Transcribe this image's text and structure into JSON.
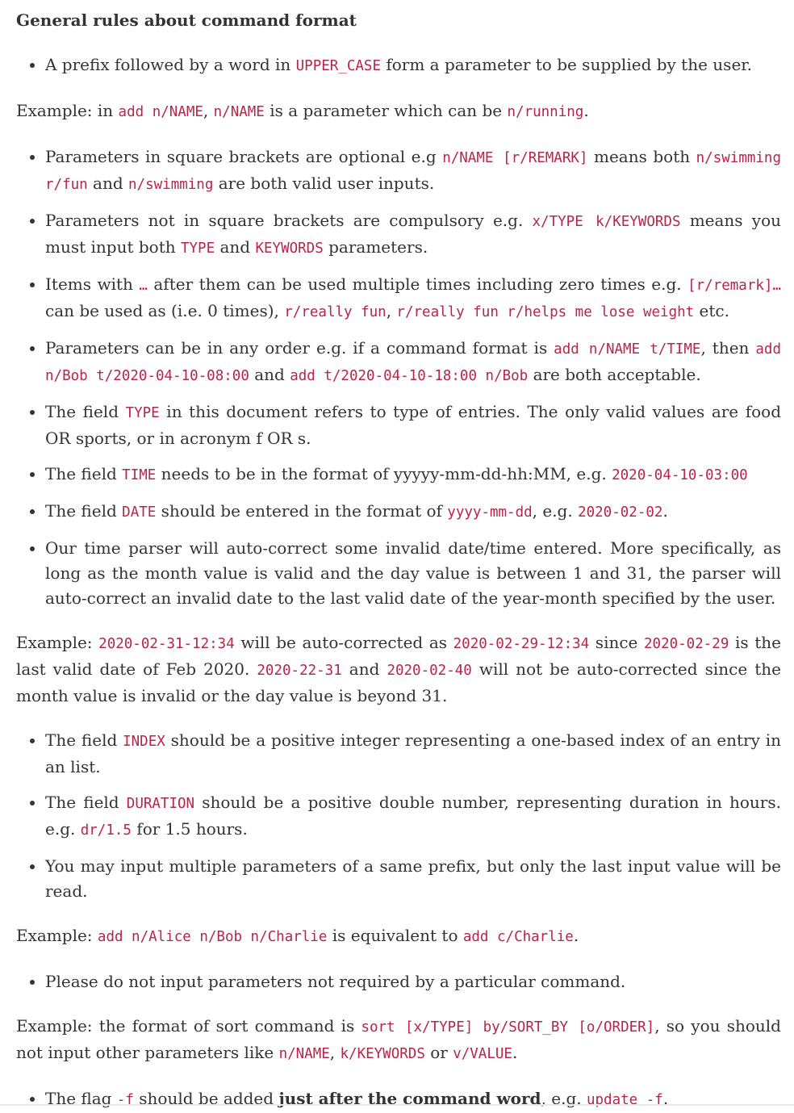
{
  "heading": "General rules about command format",
  "blocks": [
    {
      "type": "ul",
      "items": [
        [
          [
            "t",
            "A prefix followed by a word in "
          ],
          [
            "c",
            "UPPER_CASE"
          ],
          [
            "t",
            " form a parameter to be supplied by the user."
          ]
        ]
      ]
    },
    {
      "type": "p",
      "parts": [
        [
          "t",
          "Example: in "
        ],
        [
          "c",
          "add n/NAME"
        ],
        [
          "t",
          ", "
        ],
        [
          "c",
          "n/NAME"
        ],
        [
          "t",
          " is a parameter which can be "
        ],
        [
          "c",
          "n/running"
        ],
        [
          "t",
          "."
        ]
      ]
    },
    {
      "type": "ul",
      "items": [
        [
          [
            "t",
            "Parameters in square brackets are optional e.g "
          ],
          [
            "c",
            "n/NAME [r/REMARK]"
          ],
          [
            "t",
            " means both "
          ],
          [
            "c",
            "n/swimming r/fun"
          ],
          [
            "t",
            " and "
          ],
          [
            "c",
            "n/swimming"
          ],
          [
            "t",
            " are both valid user inputs."
          ]
        ],
        [
          [
            "t",
            "Parameters not in square brackets are compulsory e.g. "
          ],
          [
            "c",
            "x/TYPE k/KEYWORDS"
          ],
          [
            "t",
            " means you must input both "
          ],
          [
            "c",
            "TYPE"
          ],
          [
            "t",
            " and "
          ],
          [
            "c",
            "KEYWORDS"
          ],
          [
            "t",
            " parameters."
          ]
        ],
        [
          [
            "t",
            "Items with "
          ],
          [
            "c",
            "…"
          ],
          [
            "t",
            " after them can be used multiple times including zero times e.g. "
          ],
          [
            "c",
            "[r/remark]…"
          ],
          [
            "t",
            " can be used as "
          ],
          [
            "c",
            " "
          ],
          [
            "t",
            " (i.e. 0 times), "
          ],
          [
            "c",
            "r/really fun"
          ],
          [
            "t",
            ", "
          ],
          [
            "c",
            "r/really fun r/helps me lose weight"
          ],
          [
            "t",
            " etc."
          ]
        ],
        [
          [
            "t",
            "Parameters can be in any order e.g. if a command format is "
          ],
          [
            "c",
            "add n/NAME t/TIME"
          ],
          [
            "t",
            ", then "
          ],
          [
            "c",
            "add n/Bob t/2020-04-10-08:00"
          ],
          [
            "t",
            " and "
          ],
          [
            "c",
            "add t/2020-04-10-18:00 n/Bob"
          ],
          [
            "t",
            " are both acceptable."
          ]
        ],
        [
          [
            "t",
            "The field "
          ],
          [
            "c",
            "TYPE"
          ],
          [
            "t",
            " in this document refers to type of entries. The only valid values are food OR sports, or in acronym f OR s."
          ]
        ],
        [
          [
            "t",
            "The field "
          ],
          [
            "c",
            "TIME"
          ],
          [
            "t",
            " needs to be in the format of yyyyy-mm-dd-hh:MM, e.g. "
          ],
          [
            "c",
            "2020-04-10-03:00"
          ]
        ],
        [
          [
            "t",
            "The field "
          ],
          [
            "c",
            "DATE"
          ],
          [
            "t",
            " should be entered in the format of "
          ],
          [
            "c",
            "yyyy-mm-dd"
          ],
          [
            "t",
            ", e.g. "
          ],
          [
            "c",
            "2020-02-02"
          ],
          [
            "t",
            "."
          ]
        ],
        [
          [
            "t",
            "Our time parser will auto-correct some invalid date/time entered. More specifically, as long as the month value is valid and the day value is between 1 and 31, the parser will auto-correct an invalid date to the last valid date of the year-month specified by the user."
          ]
        ]
      ]
    },
    {
      "type": "p",
      "parts": [
        [
          "t",
          "Example: "
        ],
        [
          "c",
          "2020-02-31-12:34"
        ],
        [
          "t",
          " will be auto-corrected as "
        ],
        [
          "c",
          "2020-02-29-12:34"
        ],
        [
          "t",
          " since "
        ],
        [
          "c",
          "2020-02-29"
        ],
        [
          "t",
          " is the last valid date of Feb 2020. "
        ],
        [
          "c",
          "2020-22-31"
        ],
        [
          "t",
          " and "
        ],
        [
          "c",
          "2020-02-40"
        ],
        [
          "t",
          " will not be auto-corrected since the month value is invalid or the day value is beyond 31."
        ]
      ]
    },
    {
      "type": "ul",
      "items": [
        [
          [
            "t",
            "The field "
          ],
          [
            "c",
            "INDEX"
          ],
          [
            "t",
            " should be a positive integer representing a one-based index of an entry in an list."
          ]
        ],
        [
          [
            "t",
            "The field "
          ],
          [
            "c",
            "DURATION"
          ],
          [
            "t",
            " should be a positive double number, representing duration in hours. e.g. "
          ],
          [
            "c",
            "dr/1.5"
          ],
          [
            "t",
            " for 1.5 hours."
          ]
        ],
        [
          [
            "t",
            "You may input multiple parameters of a same prefix, but only the last input value will be read."
          ]
        ]
      ]
    },
    {
      "type": "p",
      "parts": [
        [
          "t",
          "Example: "
        ],
        [
          "c",
          "add n/Alice n/Bob n/Charlie"
        ],
        [
          "t",
          " is equivalent to "
        ],
        [
          "c",
          "add c/Charlie"
        ],
        [
          "t",
          "."
        ]
      ]
    },
    {
      "type": "ul",
      "items": [
        [
          [
            "t",
            "Please do not input parameters not required by a particular command."
          ]
        ]
      ]
    },
    {
      "type": "p",
      "parts": [
        [
          "t",
          "Example: the format of sort command is "
        ],
        [
          "c",
          "sort [x/TYPE] by/SORT_BY [o/ORDER]"
        ],
        [
          "t",
          ", so you should not input other parameters like "
        ],
        [
          "c",
          "n/NAME"
        ],
        [
          "t",
          ", "
        ],
        [
          "c",
          "k/KEYWORDS"
        ],
        [
          "t",
          " or "
        ],
        [
          "c",
          "v/VALUE"
        ],
        [
          "t",
          "."
        ]
      ]
    },
    {
      "type": "ul",
      "items": [
        [
          [
            "t",
            "The flag "
          ],
          [
            "c",
            "-f"
          ],
          [
            "t",
            " should be added "
          ],
          [
            "b",
            "just after the command word"
          ],
          [
            "t",
            ", e.g. "
          ],
          [
            "c",
            "update -f"
          ],
          [
            "t",
            "."
          ]
        ]
      ]
    }
  ]
}
